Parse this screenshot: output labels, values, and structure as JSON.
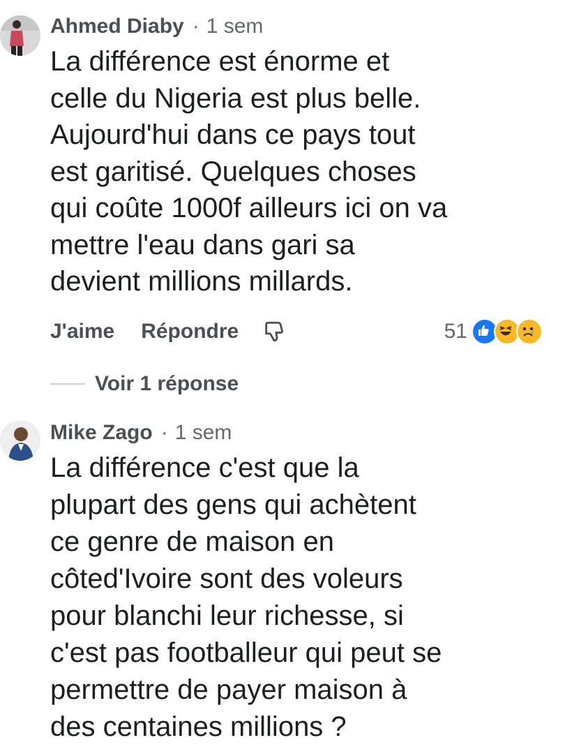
{
  "comments": [
    {
      "author": "Ahmed Diaby",
      "separator": "·",
      "time": "1 sem",
      "text_lines": [
        "La différence est énorme et",
        "celle du Nigeria est plus belle.",
        "Aujourd'hui dans ce pays tout",
        "est garitisé. Quelques choses",
        "qui coûte 1000f ailleurs ici on va",
        "mettre l'eau dans gari sa",
        "devient millions millards."
      ],
      "actions": {
        "like_label": "J'aime",
        "reply_label": "Répondre",
        "dislike_icon": "thumbs-down-icon"
      },
      "reactions": {
        "count": "51",
        "icons": [
          "like-reaction-icon",
          "haha-reaction-icon",
          "sad-reaction-icon"
        ]
      },
      "replies_label": "Voir 1 réponse"
    },
    {
      "author": "Mike Zago",
      "separator": "·",
      "time": "1 sem",
      "text_lines": [
        "La différence c'est que la",
        "plupart des gens qui achètent",
        "ce genre de maison en",
        "côted'Ivoire sont des voleurs",
        "pour blanchi leur richesse, si",
        "c'est pas footballeur qui peut se",
        "permettre de payer maison à",
        "des centaines millions ?"
      ]
    }
  ],
  "colors": {
    "text": "#1c1e21",
    "secondary": "#65676b",
    "author": "#4b4f56",
    "like_blue": "#1877f2",
    "haha_yellow": "#f7b928"
  }
}
